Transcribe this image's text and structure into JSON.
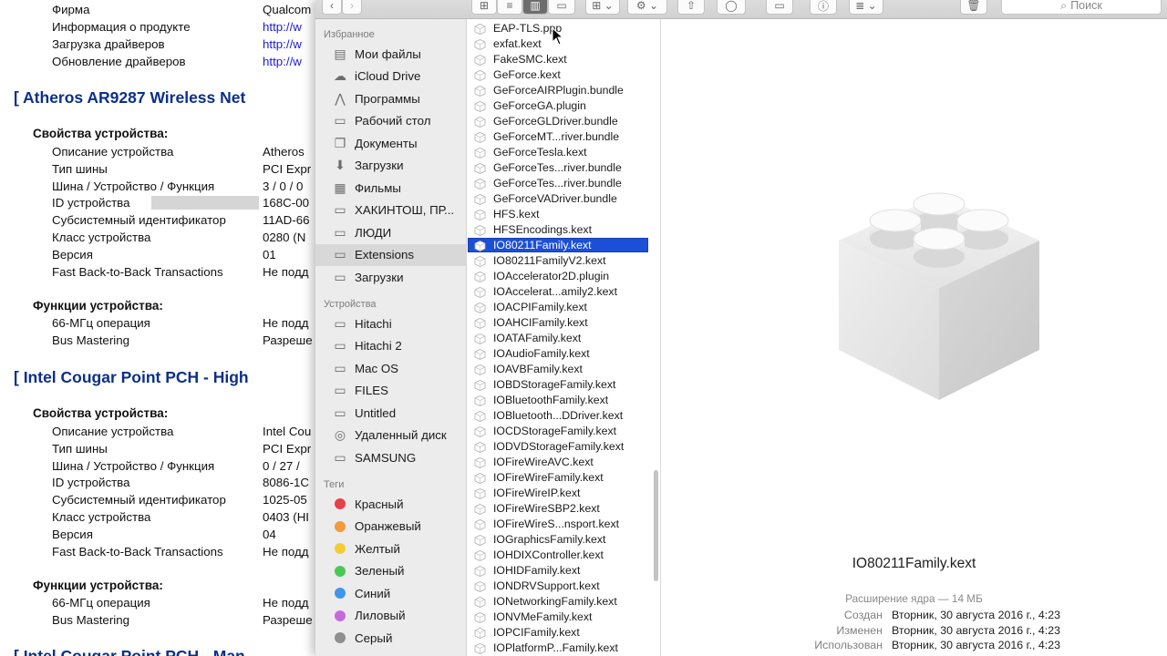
{
  "report": {
    "top_rows": [
      {
        "key": "Фирма",
        "value": "Qualcom"
      },
      {
        "key": "Информация о продукте",
        "value": "http://w"
      },
      {
        "key": "Загрузка драйверов",
        "value": "http://w"
      },
      {
        "key": "Обновление драйверов",
        "value": "http://w"
      }
    ],
    "section1": {
      "title": "[ Atheros AR9287 Wireless Net",
      "props_header": "Свойства устройства:",
      "props": [
        {
          "key": "Описание устройства",
          "value": "Atheros"
        },
        {
          "key": "Тип шины",
          "value": "PCI Expr"
        },
        {
          "key": "Шина / Устройство / Функция",
          "value": "3 / 0 / 0"
        },
        {
          "key": "ID устройства",
          "value": "168C-00"
        },
        {
          "key": "Субсистемный идентификатор",
          "value": "11AD-66"
        },
        {
          "key": "Класс устройства",
          "value": "0280 (N"
        },
        {
          "key": "Версия",
          "value": "01"
        },
        {
          "key": "Fast Back-to-Back Transactions",
          "value": "Не подд"
        }
      ],
      "func_header": "Функции устройства:",
      "funcs": [
        {
          "key": "66-МГц операция",
          "value": "Не подд"
        },
        {
          "key": "Bus Mastering",
          "value": "Разреше"
        }
      ]
    },
    "section2": {
      "title": "[ Intel Cougar Point PCH - High",
      "props_header": "Свойства устройства:",
      "props": [
        {
          "key": "Описание устройства",
          "value": "Intel Cou"
        },
        {
          "key": "Тип шины",
          "value": "PCI Expr"
        },
        {
          "key": "Шина / Устройство / Функция",
          "value": "0 / 27 /"
        },
        {
          "key": "ID устройства",
          "value": "8086-1C"
        },
        {
          "key": "Субсистемный идентификатор",
          "value": "1025-05"
        },
        {
          "key": "Класс устройства",
          "value": "0403 (HI"
        },
        {
          "key": "Версия",
          "value": "04"
        },
        {
          "key": "Fast Back-to-Back Transactions",
          "value": "Не подд"
        }
      ],
      "func_header": "Функции устройства:",
      "funcs": [
        {
          "key": "66-МГц операция",
          "value": "Не подд"
        },
        {
          "key": "Bus Mastering",
          "value": "Разреше"
        }
      ]
    },
    "section3_title": "[ Intel Cougar Point PCH - Man"
  },
  "toolbar": {
    "search_placeholder": "Поиск"
  },
  "sidebar": {
    "favorites_header": "Избранное",
    "favorites": [
      {
        "label": "Мои файлы",
        "icon": "all-files-icon",
        "glyph": "▤"
      },
      {
        "label": "iCloud Drive",
        "icon": "cloud-icon",
        "glyph": "☁"
      },
      {
        "label": "Программы",
        "icon": "applications-icon",
        "glyph": "⋀"
      },
      {
        "label": "Рабочий стол",
        "icon": "desktop-icon",
        "glyph": "▭"
      },
      {
        "label": "Документы",
        "icon": "documents-icon",
        "glyph": "❐"
      },
      {
        "label": "Загрузки",
        "icon": "downloads-icon",
        "glyph": "⬇"
      },
      {
        "label": "Фильмы",
        "icon": "movies-icon",
        "glyph": "▦"
      },
      {
        "label": "ХАКИНТОШ, ПР...",
        "icon": "folder-icon",
        "glyph": "▭"
      },
      {
        "label": "ЛЮДИ",
        "icon": "folder-icon",
        "glyph": "▭"
      },
      {
        "label": "Extensions",
        "icon": "folder-icon",
        "glyph": "▭",
        "selected": true
      },
      {
        "label": "Загрузки",
        "icon": "folder-icon",
        "glyph": "▭"
      }
    ],
    "devices_header": "Устройства",
    "devices": [
      {
        "label": "Hitachi",
        "icon": "disk-icon",
        "glyph": "▭"
      },
      {
        "label": "Hitachi 2",
        "icon": "disk-icon",
        "glyph": "▭"
      },
      {
        "label": "Mac OS",
        "icon": "disk-icon",
        "glyph": "▭"
      },
      {
        "label": "FILES",
        "icon": "disk-icon",
        "glyph": "▭"
      },
      {
        "label": "Untitled",
        "icon": "disk-icon",
        "glyph": "▭"
      },
      {
        "label": "Удаленный диск",
        "icon": "remote-disc-icon",
        "glyph": "◎"
      },
      {
        "label": "SAMSUNG",
        "icon": "disk-icon",
        "glyph": "▭"
      }
    ],
    "tags_header": "Теги",
    "tags": [
      {
        "label": "Красный",
        "color": "#e8414a"
      },
      {
        "label": "Оранжевый",
        "color": "#f39a3a"
      },
      {
        "label": "Желтый",
        "color": "#f5cc35"
      },
      {
        "label": "Зеленый",
        "color": "#4cc757"
      },
      {
        "label": "Синий",
        "color": "#3f95ee"
      },
      {
        "label": "Лиловый",
        "color": "#c46bd9"
      },
      {
        "label": "Серый",
        "color": "#8f8f8f"
      }
    ]
  },
  "files": [
    "EAP-TLS.ppp",
    "exfat.kext",
    "FakeSMC.kext",
    "GeForce.kext",
    "GeForceAIRPlugin.bundle",
    "GeForceGA.plugin",
    "GeForceGLDriver.bundle",
    "GeForceMT...river.bundle",
    "GeForceTesla.kext",
    "GeForceTes...river.bundle",
    "GeForceTes...river.bundle",
    "GeForceVADriver.bundle",
    "HFS.kext",
    "HFSEncodings.kext",
    "IO80211Family.kext",
    "IO80211FamilyV2.kext",
    "IOAccelerator2D.plugin",
    "IOAccelerat...amily2.kext",
    "IOACPIFamily.kext",
    "IOAHCIFamily.kext",
    "IOATAFamily.kext",
    "IOAudioFamily.kext",
    "IOAVBFamily.kext",
    "IOBDStorageFamily.kext",
    "IOBluetoothFamily.kext",
    "IOBluetooth...DDriver.kext",
    "IOCDStorageFamily.kext",
    "IODVDStorageFamily.kext",
    "IOFireWireAVC.kext",
    "IOFireWireFamily.kext",
    "IOFireWireIP.kext",
    "IOFireWireSBP2.kext",
    "IOFireWireS...nsport.kext",
    "IOGraphicsFamily.kext",
    "IOHDIXController.kext",
    "IOHIDFamily.kext",
    "IONDRVSupport.kext",
    "IONetworkingFamily.kext",
    "IONVMeFamily.kext",
    "IOPCIFamily.kext",
    "IOPlatformP...Family.kext"
  ],
  "selected_file": "IO80211Family.kext",
  "preview": {
    "name": "IO80211Family.kext",
    "kind": "Расширение ядра — 14 МБ",
    "meta": [
      {
        "key": "Создан",
        "value": "Вторник, 30 августа 2016 г., 4:23"
      },
      {
        "key": "Изменен",
        "value": "Вторник, 30 августа 2016 г., 4:23"
      },
      {
        "key": "Использован",
        "value": "Вторник, 30 августа 2016 г., 4:23"
      }
    ]
  }
}
